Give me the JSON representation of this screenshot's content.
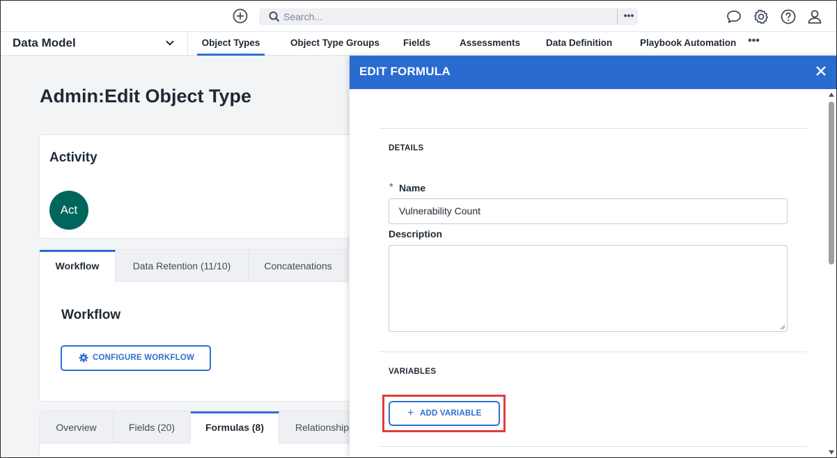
{
  "topbar": {
    "search_placeholder": "Search...",
    "search_more": "•••",
    "icons": [
      "add-circle-icon",
      "search-icon",
      "chat-icon",
      "settings-icon",
      "help-icon",
      "user-icon"
    ]
  },
  "navbar": {
    "module": "Data Model",
    "tabs": [
      {
        "label": "Object Types",
        "active": true
      },
      {
        "label": "Object Type Groups"
      },
      {
        "label": "Fields"
      },
      {
        "label": "Assessments"
      },
      {
        "label": "Data Definition"
      },
      {
        "label": "Playbook Automation"
      }
    ],
    "more": "•••"
  },
  "page": {
    "title_prefix": "Admin",
    "title_sep": ":",
    "title_main": "Edit Object Type",
    "activity": {
      "title": "Activity",
      "avatar": "Act"
    },
    "workflow_tabs": [
      {
        "label": "Workflow",
        "active": true
      },
      {
        "label": "Data Retention (11/10)"
      },
      {
        "label": "Concatenations"
      }
    ],
    "workflow": {
      "title": "Workflow",
      "button": "CONFIGURE WORKFLOW"
    },
    "bottom_tabs": [
      {
        "label": "Overview"
      },
      {
        "label": "Fields (20)"
      },
      {
        "label": "Formulas (8)",
        "active": true
      },
      {
        "label": "Relationships"
      }
    ]
  },
  "panel": {
    "title": "EDIT FORMULA",
    "details_label": "DETAILS",
    "required_mark": "*",
    "name_label": "Name",
    "name_value": "Vulnerability Count",
    "description_label": "Description",
    "description_value": "",
    "variables_label": "VARIABLES",
    "add_variable_plus": "+",
    "add_variable_label": "ADD VARIABLE",
    "highlight_color": "#e03c3c",
    "accent_color": "#2a6bd0"
  }
}
